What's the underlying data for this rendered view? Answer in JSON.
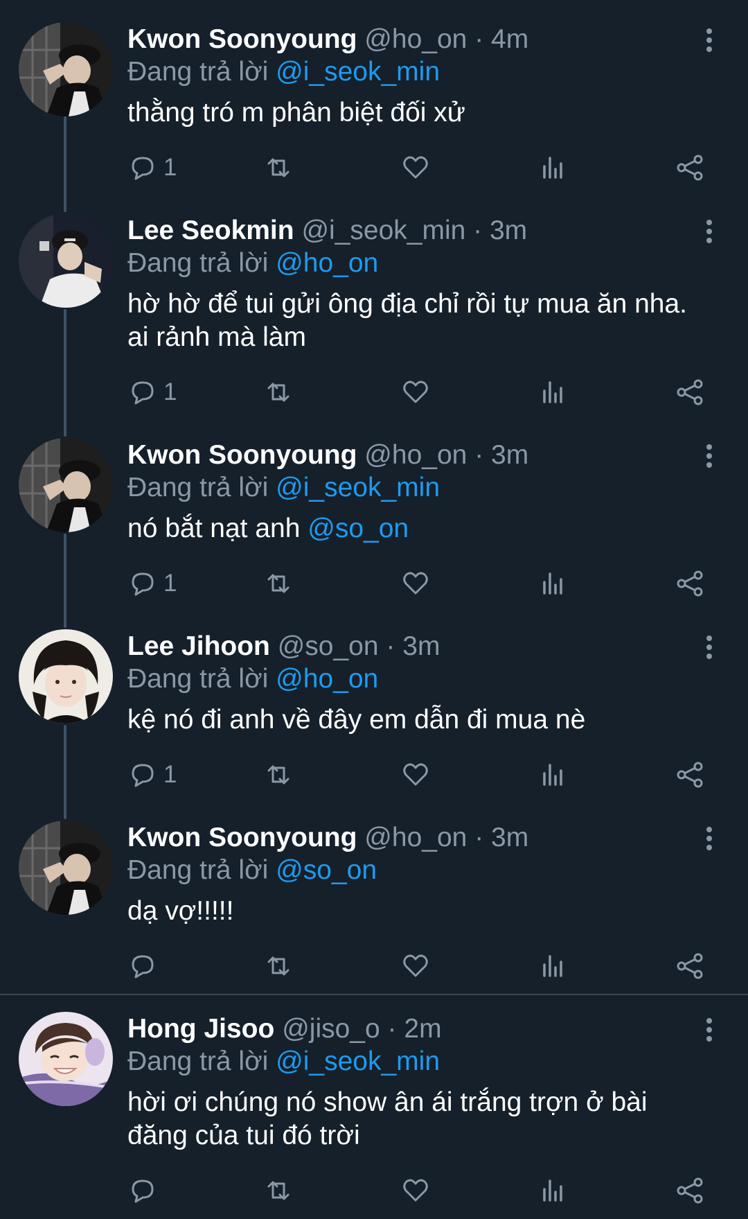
{
  "colors": {
    "background": "#15202b",
    "text_primary": "#ffffff",
    "text_secondary": "#8b98a5",
    "mention": "#1d9bf0",
    "thread_line": "#3d5466"
  },
  "replying_label": "Đang trả lời",
  "icons": {
    "reply": "reply-icon",
    "retweet": "retweet-icon",
    "like": "heart-icon",
    "analytics": "analytics-icon",
    "share": "share-icon",
    "more": "more-vertical-icon"
  },
  "tweets": [
    {
      "name": "Kwon Soonyoung",
      "handle": "@ho_on",
      "dot": "·",
      "time": "4m",
      "replying_to": "@i_seok_min",
      "text": "thằng tró m phân biệt đối xử",
      "reply_count": "1",
      "avatar": "avatar-dark-cap"
    },
    {
      "name": "Lee Seokmin",
      "handle": "@i_seok_min",
      "dot": "·",
      "time": "3m",
      "replying_to": "@ho_on",
      "text_line1": "hờ hờ để tui gửi ông địa chỉ rồi tự mua ăn nha.",
      "text_line2": "ai rảnh mà làm",
      "reply_count": "1",
      "avatar": "avatar-cap-white"
    },
    {
      "name": "Kwon Soonyoung",
      "handle": "@ho_on",
      "dot": "·",
      "time": "3m",
      "replying_to": "@i_seok_min",
      "text_prefix": "nó bắt nạt anh ",
      "text_mention": "@so_on",
      "reply_count": "1",
      "avatar": "avatar-dark-cap"
    },
    {
      "name": "Lee Jihoon",
      "handle": "@so_on",
      "dot": "·",
      "time": "3m",
      "replying_to": "@ho_on",
      "text": "kệ nó đi anh về đây em dẫn đi mua nè",
      "reply_count": "1",
      "avatar": "avatar-dark-hair"
    },
    {
      "name": "Kwon Soonyoung",
      "handle": "@ho_on",
      "dot": "·",
      "time": "3m",
      "replying_to": "@so_on",
      "text": "dạ vợ!!!!!",
      "reply_count": "",
      "avatar": "avatar-dark-cap"
    },
    {
      "name": "Hong Jisoo",
      "handle": "@jiso_o",
      "dot": "·",
      "time": "2m",
      "replying_to": "@i_seok_min",
      "text_line1": "hời ơi chúng nó show ân ái trắng trợn ở bài",
      "text_line2": "đăng của tui đó trời",
      "reply_count": "",
      "avatar": "avatar-smiling"
    }
  ]
}
